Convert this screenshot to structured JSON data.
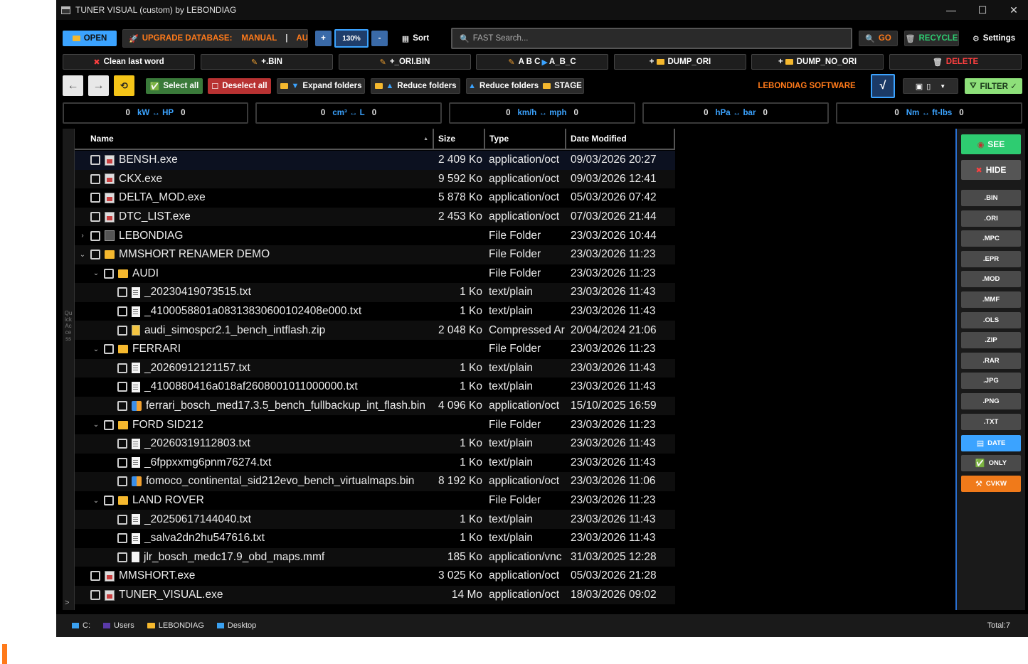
{
  "title": "TUNER VISUAL (custom) by LEBONDIAG",
  "window_controls": {
    "minimize": "—",
    "maximize": "☐",
    "close": "✕"
  },
  "toolbar1": {
    "open": "OPEN",
    "upgrade_label": "UPGRADE DATABASE:",
    "manual": "MANUAL",
    "separator": "|",
    "auto": "AUTO",
    "zoom_in": "+",
    "zoom": "130%",
    "zoom_out": "-",
    "sort": "Sort",
    "search_placeholder": "FAST Search...",
    "go": "GO",
    "recycle": "RECYCLE",
    "settings": "Settings"
  },
  "toolbar2": {
    "clean": "Clean last word",
    "plus_bin": "+.BIN",
    "plus_ori_bin": "+_ORI.BIN",
    "abc": "A B C",
    "abc2": "A_B_C",
    "dump_ori": "DUMP_ORI",
    "dump_no_ori": "DUMP_NO_ORI",
    "delete": "DELETE"
  },
  "toolbar3": {
    "back": "←",
    "forward": "→",
    "select_all": "Select all",
    "deselect_all": "Deselect all",
    "expand": "Expand folders",
    "reduce": "Reduce folders",
    "reduce_stage": "Reduce folders",
    "stage": "STAGE",
    "brand": "LEBONDIAG SOFTWARE",
    "check": "√",
    "filter": "FILTER ✓"
  },
  "converters": [
    {
      "left": "0",
      "label": "kW ↔ HP",
      "right": "0"
    },
    {
      "left": "0",
      "label": "cm³ ↔ L",
      "right": "0"
    },
    {
      "left": "0",
      "label": "km/h ↔ mph",
      "right": "0"
    },
    {
      "left": "0",
      "label": "hPa ↔ bar",
      "right": "0"
    },
    {
      "left": "0",
      "label": "Nm ↔ ft-lbs",
      "right": "0"
    }
  ],
  "quick_access": "Quick Access",
  "quick_arrow": ">",
  "columns": {
    "name": "Name",
    "size": "Size",
    "type": "Type",
    "date": "Date Modified",
    "sort_arrow": "▲"
  },
  "rows": [
    {
      "indent": 0,
      "exp": "",
      "icon": "exe",
      "name": "BENSH.exe",
      "size": "2 409 Ko",
      "type": "application/oct",
      "date": "09/03/2026 20:27"
    },
    {
      "indent": 0,
      "exp": "",
      "icon": "exe",
      "name": "CKX.exe",
      "size": "9 592 Ko",
      "type": "application/oct",
      "date": "09/03/2026 12:41"
    },
    {
      "indent": 0,
      "exp": "",
      "icon": "exe",
      "name": "DELTA_MOD.exe",
      "size": "5 878 Ko",
      "type": "application/oct",
      "date": "05/03/2026 07:42"
    },
    {
      "indent": 0,
      "exp": "",
      "icon": "exe",
      "name": "DTC_LIST.exe",
      "size": "2 453 Ko",
      "type": "application/oct",
      "date": "07/03/2026 21:44"
    },
    {
      "indent": 0,
      "exp": "›",
      "icon": "app",
      "name": "LEBONDIAG",
      "size": "",
      "type": "File Folder",
      "date": "23/03/2026 10:44"
    },
    {
      "indent": 0,
      "exp": "⌄",
      "icon": "fold2",
      "name": "MMSHORT RENAMER DEMO",
      "size": "",
      "type": "File Folder",
      "date": "23/03/2026 11:23"
    },
    {
      "indent": 1,
      "exp": "⌄",
      "icon": "fold2",
      "name": "AUDI",
      "size": "",
      "type": "File Folder",
      "date": "23/03/2026 11:23"
    },
    {
      "indent": 2,
      "exp": "",
      "icon": "txt",
      "name": "_20230419073515.txt",
      "size": "1 Ko",
      "type": "text/plain",
      "date": "23/03/2026 11:43"
    },
    {
      "indent": 2,
      "exp": "",
      "icon": "txt",
      "name": "_4100058801a08313830600102408e000.txt",
      "size": "1 Ko",
      "type": "text/plain",
      "date": "23/03/2026 11:43"
    },
    {
      "indent": 2,
      "exp": "",
      "icon": "zip",
      "name": "audi_simospcr2.1_bench_intflash.zip",
      "size": "2 048 Ko",
      "type": "Compressed Ar",
      "date": "20/04/2024 21:06"
    },
    {
      "indent": 1,
      "exp": "⌄",
      "icon": "fold2",
      "name": "FERRARI",
      "size": "",
      "type": "File Folder",
      "date": "23/03/2026 11:23"
    },
    {
      "indent": 2,
      "exp": "",
      "icon": "txt",
      "name": "_20260912121157.txt",
      "size": "1 Ko",
      "type": "text/plain",
      "date": "23/03/2026 11:43"
    },
    {
      "indent": 2,
      "exp": "",
      "icon": "txt",
      "name": "_4100880416a018af2608001011000000.txt",
      "size": "1 Ko",
      "type": "text/plain",
      "date": "23/03/2026 11:43"
    },
    {
      "indent": 2,
      "exp": "",
      "icon": "bin",
      "name": "ferrari_bosch_med17.3.5_bench_fullbackup_int_flash.bin",
      "size": "4 096 Ko",
      "type": "application/oct",
      "date": "15/10/2025 16:59"
    },
    {
      "indent": 1,
      "exp": "⌄",
      "icon": "fold2",
      "name": "FORD SID212",
      "size": "",
      "type": "File Folder",
      "date": "23/03/2026 11:23"
    },
    {
      "indent": 2,
      "exp": "",
      "icon": "txt",
      "name": "_20260319112803.txt",
      "size": "1 Ko",
      "type": "text/plain",
      "date": "23/03/2026 11:43"
    },
    {
      "indent": 2,
      "exp": "",
      "icon": "txt",
      "name": "_6fppxxmg6pnm76274.txt",
      "size": "1 Ko",
      "type": "text/plain",
      "date": "23/03/2026 11:43"
    },
    {
      "indent": 2,
      "exp": "",
      "icon": "bin",
      "name": "fomoco_continental_sid212evo_bench_virtualmaps.bin",
      "size": "8 192 Ko",
      "type": "application/oct",
      "date": "23/03/2026 11:06"
    },
    {
      "indent": 1,
      "exp": "⌄",
      "icon": "fold2",
      "name": "LAND ROVER",
      "size": "",
      "type": "File Folder",
      "date": "23/03/2026 11:23"
    },
    {
      "indent": 2,
      "exp": "",
      "icon": "txt",
      "name": "_20250617144040.txt",
      "size": "1 Ko",
      "type": "text/plain",
      "date": "23/03/2026 11:43"
    },
    {
      "indent": 2,
      "exp": "",
      "icon": "txt",
      "name": "_salva2dn2hu547616.txt",
      "size": "1 Ko",
      "type": "text/plain",
      "date": "23/03/2026 11:43"
    },
    {
      "indent": 2,
      "exp": "",
      "icon": "mmf",
      "name": "jlr_bosch_medc17.9_obd_maps.mmf",
      "size": "185 Ko",
      "type": "application/vnc",
      "date": "31/03/2025 12:28"
    },
    {
      "indent": 0,
      "exp": "",
      "icon": "exe",
      "name": "MMSHORT.exe",
      "size": "3 025 Ko",
      "type": "application/oct",
      "date": "05/03/2026 21:28"
    },
    {
      "indent": 0,
      "exp": "",
      "icon": "exe",
      "name": "TUNER_VISUAL.exe",
      "size": "14 Mo",
      "type": "application/oct",
      "date": "18/03/2026 09:02"
    }
  ],
  "right_panel": {
    "see": "SEE",
    "hide": "HIDE",
    "ext": [
      ".BIN",
      ".ORI",
      ".MPC",
      ".EPR",
      ".MOD",
      ".MMF",
      ".OLS",
      ".ZIP",
      ".RAR",
      ".JPG",
      ".PNG",
      ".TXT"
    ],
    "date": "DATE",
    "only": "ONLY",
    "cvkw": "CVKW"
  },
  "status": {
    "drive": "C:",
    "users": "Users",
    "lebondiag": "LEBONDIAG",
    "desktop": "Desktop",
    "total": "Total:7"
  },
  "colors": {
    "accent": "#3ba3ff",
    "orange": "#ff7a1a",
    "red": "#c0392b",
    "green": "#2ecc71"
  }
}
